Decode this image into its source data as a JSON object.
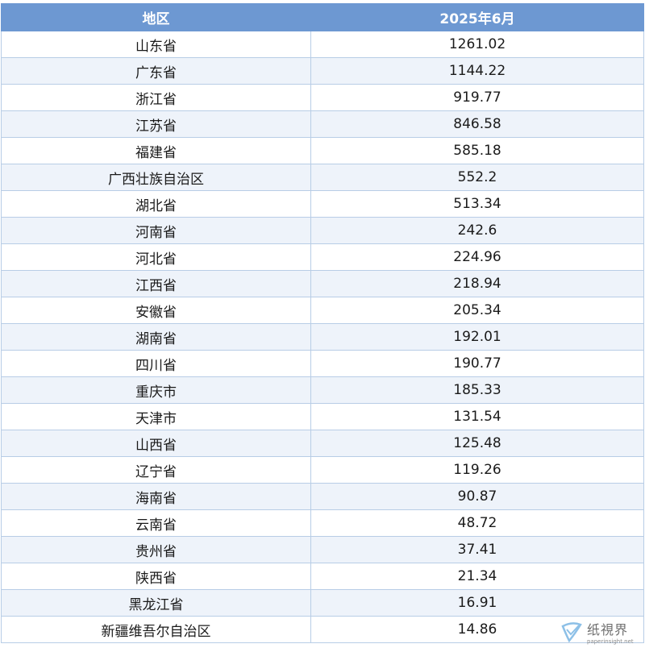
{
  "table": {
    "headers": [
      "地区",
      "2025年6月"
    ],
    "rows": [
      [
        "山东省",
        "1261.02"
      ],
      [
        "广东省",
        "1144.22"
      ],
      [
        "浙江省",
        "919.77"
      ],
      [
        "江苏省",
        "846.58"
      ],
      [
        "福建省",
        "585.18"
      ],
      [
        "广西壮族自治区",
        "552.2"
      ],
      [
        "湖北省",
        "513.34"
      ],
      [
        "河南省",
        "242.6"
      ],
      [
        "河北省",
        "224.96"
      ],
      [
        "江西省",
        "218.94"
      ],
      [
        "安徽省",
        "205.34"
      ],
      [
        "湖南省",
        "192.01"
      ],
      [
        "四川省",
        "190.77"
      ],
      [
        "重庆市",
        "185.33"
      ],
      [
        "天津市",
        "131.54"
      ],
      [
        "山西省",
        "125.48"
      ],
      [
        "辽宁省",
        "119.26"
      ],
      [
        "海南省",
        "90.87"
      ],
      [
        "云南省",
        "48.72"
      ],
      [
        "贵州省",
        "37.41"
      ],
      [
        "陕西省",
        "21.34"
      ],
      [
        "黑龙江省",
        "16.91"
      ],
      [
        "新疆维吾尔自治区",
        "14.86"
      ]
    ]
  },
  "watermark": {
    "text_cn": "纸視界",
    "text_en": "paperinsight.net"
  },
  "colors": {
    "header_bg": "#6d98d2",
    "stripe": "#eef3fa",
    "border": "#b8cde6"
  }
}
